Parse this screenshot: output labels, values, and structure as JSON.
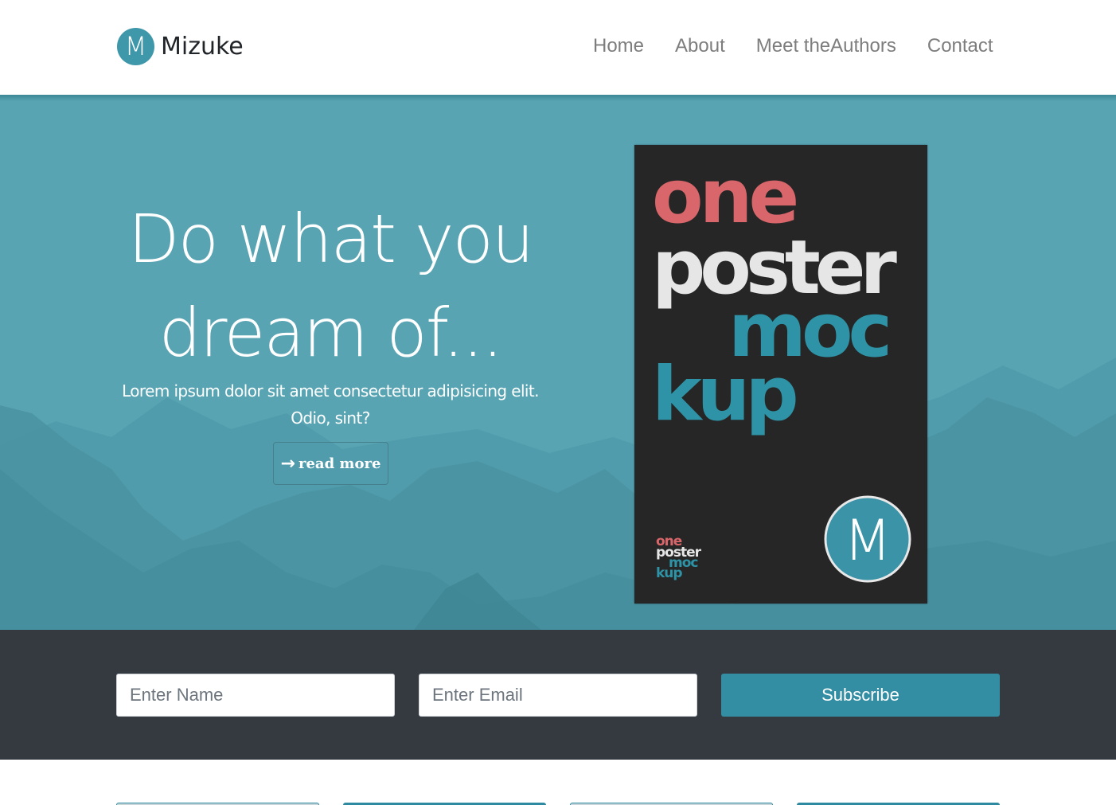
{
  "header": {
    "logo_letter": "M",
    "brand": "Mizuke",
    "nav": [
      "Home",
      "About",
      "Meet theAuthors",
      "Contact"
    ]
  },
  "hero": {
    "title_line1": "Do what you",
    "title_line2": "dream of...",
    "subtitle": "Lorem ipsum dolor sit amet consectetur adipisicing elit. Odio, sint?",
    "button_label": "read more",
    "button_icon": "arrow-right-icon"
  },
  "poster": {
    "words": [
      "one",
      "poster",
      "moc",
      "kup"
    ],
    "logo_letter": "M"
  },
  "subscribe": {
    "name_placeholder": "Enter Name",
    "email_placeholder": "Enter Email",
    "button_label": "Subscribe"
  },
  "colors": {
    "accent": "#338ea4",
    "hero_bg": "#58a4b3",
    "dark_bar": "#343a40",
    "poster_red": "#d9666a",
    "poster_teal": "#2e93a6"
  }
}
